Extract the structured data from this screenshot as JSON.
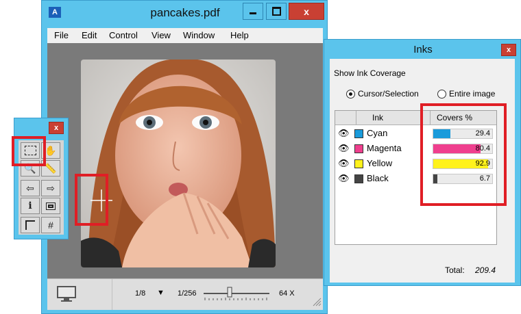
{
  "main_window": {
    "app_icon": "A",
    "title": "pancakes.pdf",
    "minimize_glyph": "–",
    "maximize_glyph": "□",
    "close_glyph": "x",
    "menu": [
      "File",
      "Edit",
      "Control",
      "View",
      "Window",
      "Help"
    ],
    "status": {
      "zoom": "1/8",
      "zoom_dropdown_glyph": "▼",
      "slider_min": "1/256",
      "slider_max": "64 X"
    }
  },
  "tools": {
    "close_glyph": "x"
  },
  "inks": {
    "title": "Inks",
    "close_glyph": "x",
    "show_coverage_label": "Show Ink Coverage",
    "option_cursor": "Cursor/Selection",
    "option_entire": "Entire image",
    "column_ink": "Ink",
    "column_covers": "Covers %",
    "rows": [
      {
        "name": "Cyan",
        "value": "29.4",
        "coverage": 29.4,
        "color": "#1a9bdb"
      },
      {
        "name": "Magenta",
        "value": "80.4",
        "coverage": 80.4,
        "color": "#ef3f8e"
      },
      {
        "name": "Yellow",
        "value": "92.9",
        "coverage": 92.9,
        "color": "#fff21c"
      },
      {
        "name": "Black",
        "value": "6.7",
        "coverage": 6.7,
        "color": "#444444"
      }
    ],
    "total_label": "Total:",
    "total_value": "209.4"
  },
  "colors": {
    "window_chrome": "#5bc4ec",
    "highlight": "#e01e25",
    "close_button": "#c94033"
  }
}
